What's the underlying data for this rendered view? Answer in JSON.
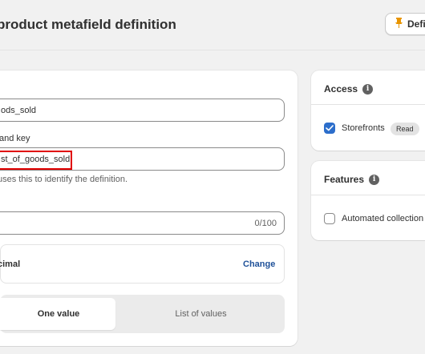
{
  "header": {
    "title": "product metafield definition",
    "pin_button_label": "Defi"
  },
  "form": {
    "name_value": "ods_sold",
    "key_label": "and key",
    "key_value": "st_of_goods_sold",
    "key_help": "uses this to identify the definition.",
    "description_counter": "0/100",
    "type_label": "cimal",
    "change_label": "Change",
    "value_options": [
      "One value",
      "List of values"
    ]
  },
  "access": {
    "title": "Access",
    "storefronts_label": "Storefronts",
    "storefronts_checked": true,
    "storefronts_badge": "Read"
  },
  "features": {
    "title": "Features",
    "automated_label": "Automated collection",
    "automated_checked": false
  },
  "colors": {
    "accent": "#2c6ecb",
    "link": "#1f5199",
    "highlight": "#e00000"
  }
}
